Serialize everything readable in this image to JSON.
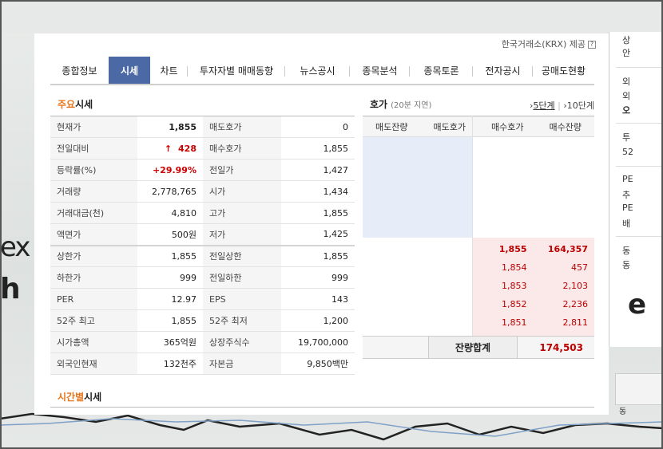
{
  "provider": {
    "text": "한국거래소(KRX) 제공",
    "help_icon": "?"
  },
  "tabs": [
    {
      "label": "종합정보",
      "active": false
    },
    {
      "label": "시세",
      "active": true
    },
    {
      "label": "차트",
      "active": false
    },
    {
      "label": "투자자별 매매동향",
      "active": false
    },
    {
      "label": "뉴스공시",
      "active": false
    },
    {
      "label": "종목분석",
      "active": false
    },
    {
      "label": "종목토론",
      "active": false
    },
    {
      "label": "전자공시",
      "active": false
    },
    {
      "label": "공매도현황",
      "active": false
    }
  ],
  "main_quote": {
    "title_accent": "주요",
    "title_rest": "시세",
    "rows": [
      {
        "k1": "현재가",
        "v1": "1,855",
        "k2": "매도호가",
        "v2": "0"
      },
      {
        "k1": "전일대비",
        "v1": "428",
        "k2": "매수호가",
        "v2": "1,855"
      },
      {
        "k1": "등락률(%)",
        "v1": "+29.99%",
        "k2": "전일가",
        "v2": "1,427"
      },
      {
        "k1": "거래량",
        "v1": "2,778,765",
        "k2": "시가",
        "v2": "1,434"
      },
      {
        "k1": "거래대금(천)",
        "v1": "4,810",
        "k2": "고가",
        "v2": "1,855"
      },
      {
        "k1": "액면가",
        "v1": "500원",
        "k2": "저가",
        "v2": "1,425"
      },
      {
        "k1": "상한가",
        "v1": "1,855",
        "k2": "전일상한",
        "v2": "1,855"
      },
      {
        "k1": "하한가",
        "v1": "999",
        "k2": "전일하한",
        "v2": "999"
      },
      {
        "k1": "PER",
        "v1": "12.97",
        "k2": "EPS",
        "v2": "143"
      },
      {
        "k1": "52주 최고",
        "v1": "1,855",
        "k2": "52주 최저",
        "v2": "1,200"
      },
      {
        "k1": "시가총액",
        "v1": "365억원",
        "k2": "상장주식수",
        "v2": "19,700,000"
      },
      {
        "k1": "외국인현재",
        "v1": "132천주",
        "k2": "자본금",
        "v2": "9,850백만"
      }
    ],
    "up_arrow": "↑"
  },
  "orderbook": {
    "title": "호가",
    "subtitle": "(20분 지연)",
    "link_5": "5단계",
    "link_10": "10단계",
    "headers": [
      "매도잔량",
      "매도호가",
      "매수호가",
      "매수잔량"
    ],
    "bids": [
      {
        "price": "1,855",
        "qty": "164,357"
      },
      {
        "price": "1,854",
        "qty": "457"
      },
      {
        "price": "1,853",
        "qty": "2,103"
      },
      {
        "price": "1,852",
        "qty": "2,236"
      },
      {
        "price": "1,851",
        "qty": "2,811"
      }
    ],
    "total_label": "잔량합계",
    "total_value": "174,503"
  },
  "time_section": {
    "title_accent": "시간별",
    "title_rest": "시세"
  },
  "background": {
    "left_text_1": "ex",
    "left_text_2": "h",
    "right_text": "e",
    "sidebar": [
      "상",
      "안",
      "외",
      "외",
      "오",
      "투",
      "52",
      "PE",
      "추",
      "PE",
      "배",
      "동",
      "동"
    ],
    "bottom_box": "동"
  }
}
